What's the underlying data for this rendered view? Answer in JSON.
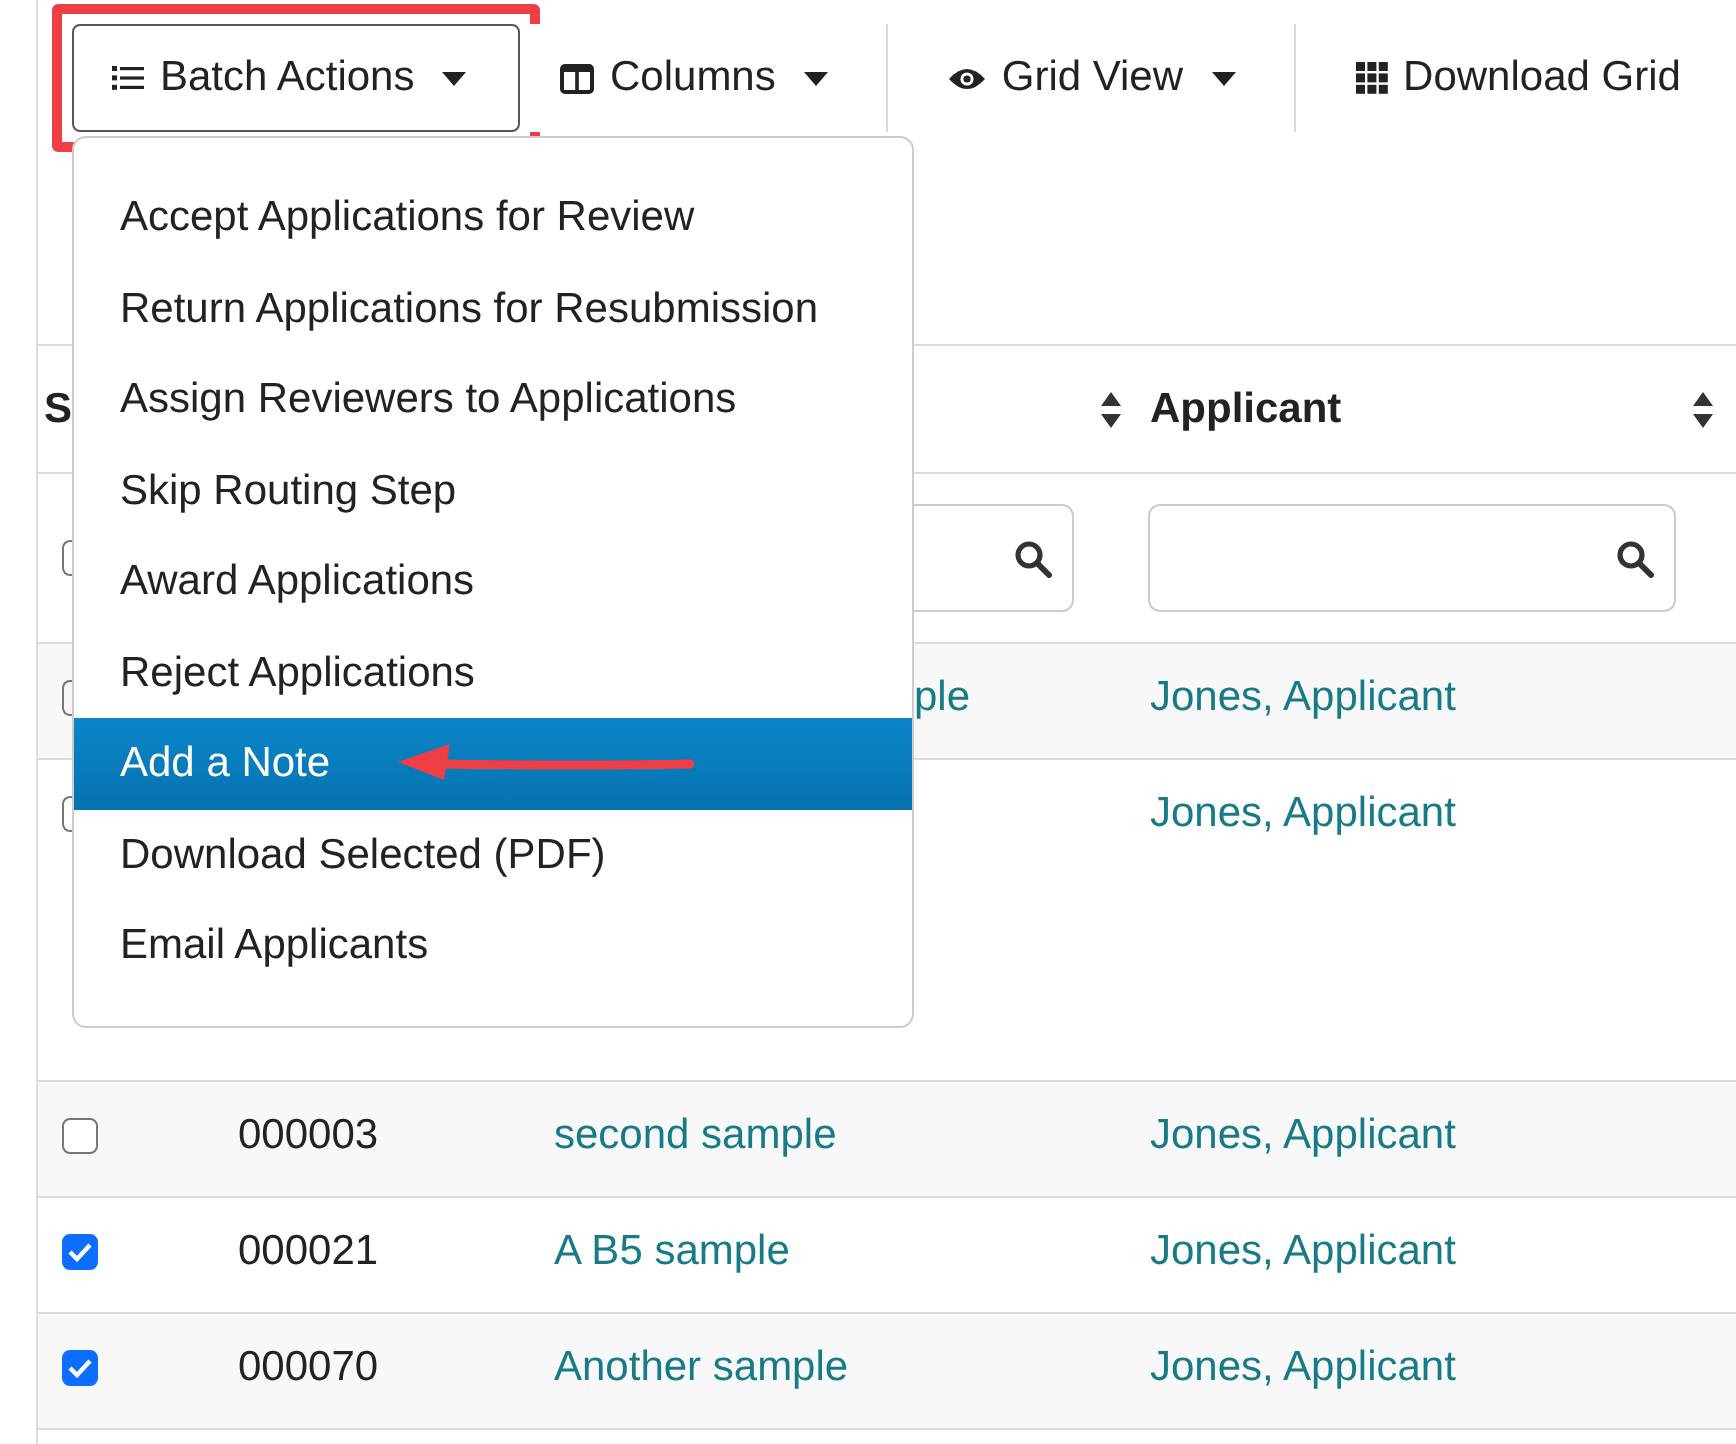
{
  "toolbar": {
    "buttons": [
      {
        "label": "Batch Actions",
        "dropdown": true,
        "highlighted": true
      },
      {
        "label": "Columns",
        "dropdown": true,
        "highlighted": false
      },
      {
        "label": "Grid View",
        "dropdown": true,
        "highlighted": false
      },
      {
        "label": "Download Grid",
        "dropdown": false,
        "highlighted": false
      }
    ]
  },
  "menu": {
    "items": [
      {
        "label": "Accept Applications for Review",
        "selected": false,
        "pointed": false
      },
      {
        "label": "Return Applications for Resubmission",
        "selected": false,
        "pointed": false
      },
      {
        "label": "Assign Reviewers to Applications",
        "selected": false,
        "pointed": false
      },
      {
        "label": "Skip Routing Step",
        "selected": false,
        "pointed": false
      },
      {
        "label": "Award Applications",
        "selected": false,
        "pointed": false
      },
      {
        "label": "Reject Applications",
        "selected": false,
        "pointed": false
      },
      {
        "label": "Add a Note",
        "selected": true,
        "pointed": true
      },
      {
        "label": "Download Selected (PDF)",
        "selected": false,
        "pointed": false
      },
      {
        "label": "Email Applicants",
        "selected": false,
        "pointed": false
      }
    ]
  },
  "table": {
    "header": {
      "column_1": "S",
      "column_4": "Applicant"
    },
    "rows": [
      {
        "title": "ple",
        "applicant": "Jones, Applicant"
      },
      {
        "applicant": "Jones, Applicant"
      },
      {
        "checked": false,
        "id": "000003",
        "title": "second sample",
        "applicant": "Jones, Applicant"
      },
      {
        "checked": true,
        "id": "000021",
        "title": "A B5 sample",
        "applicant": "Jones, Applicant"
      },
      {
        "checked": true,
        "id": "000070",
        "title": "Another sample",
        "applicant": "Jones, Applicant"
      }
    ]
  }
}
